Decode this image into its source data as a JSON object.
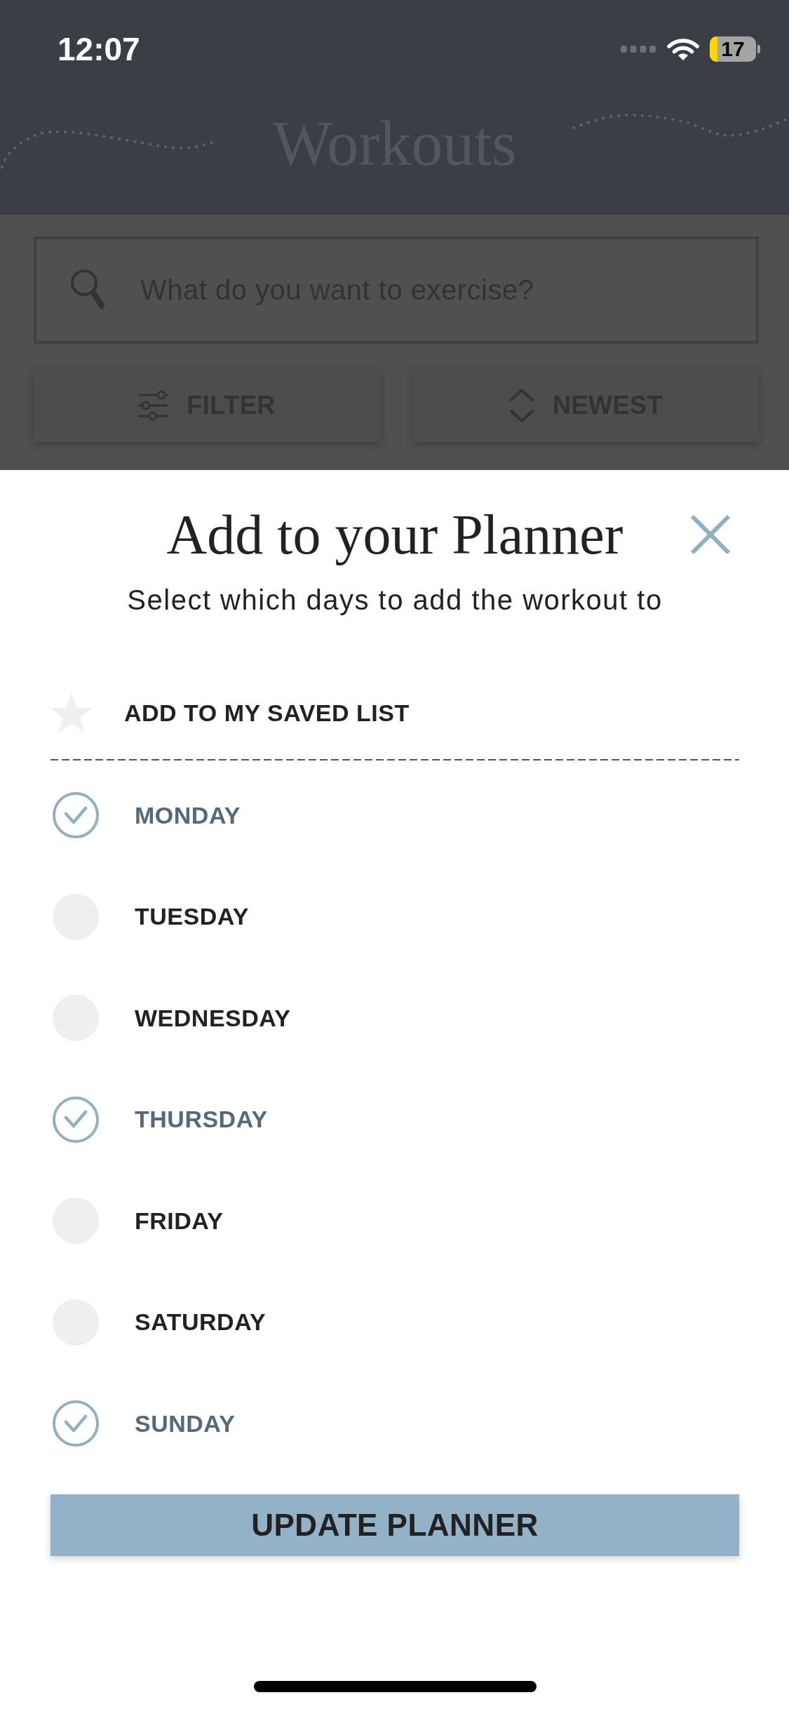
{
  "status_bar": {
    "time": "12:07",
    "battery": "17"
  },
  "header": {
    "title": "Workouts"
  },
  "search": {
    "placeholder": "What do you want to exercise?"
  },
  "toolbar": [
    {
      "kind": "filter",
      "label": "FILTER"
    },
    {
      "kind": "sort",
      "label": "NEWEST"
    }
  ],
  "dialog": {
    "title": "Add to your Planner",
    "subtitle": "Select which days to add the workout to",
    "saved": {
      "label": "ADD TO MY SAVED LIST",
      "checked": false
    },
    "days": [
      {
        "label": "MONDAY",
        "checked": true
      },
      {
        "label": "TUESDAY",
        "checked": false
      },
      {
        "label": "WEDNESDAY",
        "checked": false
      },
      {
        "label": "THURSDAY",
        "checked": true
      },
      {
        "label": "FRIDAY",
        "checked": false
      },
      {
        "label": "SATURDAY",
        "checked": false
      },
      {
        "label": "SUNDAY",
        "checked": true
      }
    ],
    "button": "UPDATE PLANNER"
  }
}
